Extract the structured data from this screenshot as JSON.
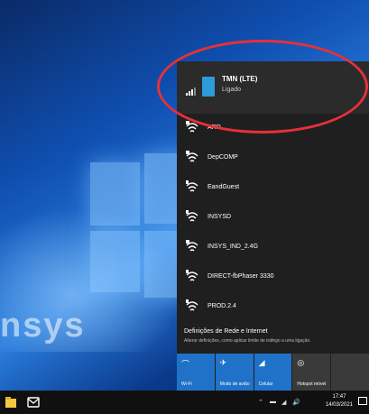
{
  "desktop": {
    "wallpaper_text": "nsys"
  },
  "flyout": {
    "connected": {
      "name": "TMN (LTE)",
      "status": "Ligado"
    },
    "networks": [
      {
        "name": "ARD"
      },
      {
        "name": "DepCOMP"
      },
      {
        "name": "EandGuest"
      },
      {
        "name": "INSYSD"
      },
      {
        "name": "INSYS_IND_2.4G"
      },
      {
        "name": "DIRECT-fbPhaser 3330"
      },
      {
        "name": "PROD.2.4"
      }
    ],
    "settings": {
      "title": "Definições de Rede e Internet",
      "subtitle": "Alterar definições, como aplicar limite de tráfego a uma ligação."
    },
    "quick_actions": [
      {
        "label": "Wi-Fi",
        "icon": "wifi-icon",
        "active": true
      },
      {
        "label": "Modo de avião",
        "icon": "airplane-icon",
        "active": true
      },
      {
        "label": "Celular",
        "icon": "cellular-icon",
        "active": true
      },
      {
        "label": "Hotspot móvel",
        "icon": "hotspot-icon",
        "active": false
      },
      {
        "label": "",
        "icon": "",
        "active": false
      }
    ]
  },
  "taskbar": {
    "time": "17:47",
    "date": "14/03/2021"
  },
  "colors": {
    "accent": "#1f72c7",
    "flyout_bg": "#1f1f1f",
    "connected_bg": "#2b2b2b",
    "highlight": "#e5303a",
    "taskbar_bg": "#101010"
  }
}
